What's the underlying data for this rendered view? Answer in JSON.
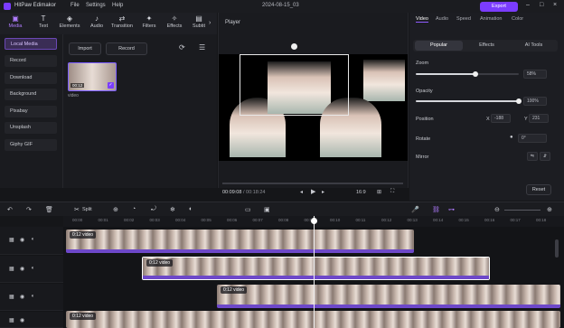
{
  "titlebar": {
    "app_name": "HitPaw Edimakor",
    "menu": [
      "File",
      "Settings",
      "Help"
    ],
    "project_date": "2024-08-15_03",
    "export_label": "Export"
  },
  "toolbar": {
    "items": [
      {
        "label": "Media",
        "icon": "folder-icon"
      },
      {
        "label": "Text",
        "icon": "text-icon"
      },
      {
        "label": "Elements",
        "icon": "elements-icon"
      },
      {
        "label": "Audio",
        "icon": "music-icon"
      },
      {
        "label": "Transition",
        "icon": "transition-icon"
      },
      {
        "label": "Filters",
        "icon": "filters-icon"
      },
      {
        "label": "Effects",
        "icon": "effects-icon"
      },
      {
        "label": "Subtit",
        "icon": "subtitle-icon"
      }
    ]
  },
  "sidebar": {
    "items": [
      "Local Media",
      "Record",
      "Download",
      "Background",
      "Pixabay",
      "Unsplash",
      "Giphy GIF"
    ]
  },
  "library": {
    "import_label": "Import",
    "record_label": "Record",
    "thumb_duration": "00:12",
    "thumb_label": "video"
  },
  "player": {
    "title": "Player",
    "current_time": "00:09:08",
    "total_time": "/ 00:18:24",
    "ratio": "16:9"
  },
  "props": {
    "tabs": [
      "Video",
      "Audio",
      "Speed",
      "Animation",
      "Color"
    ],
    "subtabs": [
      "Popular",
      "Effects",
      "AI Tools"
    ],
    "zoom_label": "Zoom",
    "zoom_value": "58%",
    "zoom_fraction": 0.58,
    "opacity_label": "Opacity",
    "opacity_value": "100%",
    "opacity_fraction": 1.0,
    "position_label": "Position",
    "x_label": "X",
    "x_value": "-188",
    "y_label": "Y",
    "y_value": "231",
    "rotate_label": "Rotate",
    "rotate_value": "0°",
    "mirror_label": "Mirror",
    "reset_label": "Reset"
  },
  "timeline": {
    "split_label": "Split",
    "ruler": [
      "00:00",
      "00:01",
      "00:02",
      "00:03",
      "00:04",
      "00:05",
      "00:06",
      "00:07",
      "00:08",
      "00:09",
      "00:10",
      "00:11",
      "00:12",
      "00:13",
      "00:14",
      "00:15",
      "00:16",
      "00:17",
      "00:18"
    ],
    "clips": [
      {
        "label": "0:12 video"
      },
      {
        "label": "0:12 video"
      },
      {
        "label": "0:12 video"
      },
      {
        "label": "0:12 video"
      }
    ]
  }
}
